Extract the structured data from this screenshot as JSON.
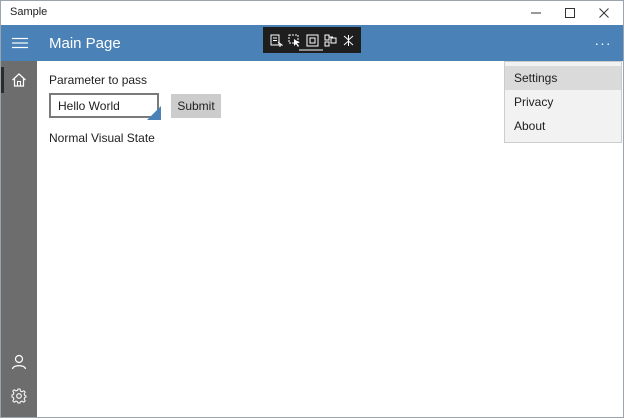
{
  "window": {
    "title": "Sample"
  },
  "title_bar_controls": {
    "minimize_icon": "minimize-icon",
    "maximize_icon": "maximize-icon",
    "close_icon": "close-icon"
  },
  "header": {
    "page_title": "Main Page",
    "menu_icon": "hamburger-icon",
    "more_icon": "more-icon",
    "more_label": "···",
    "color": "#4a82b8"
  },
  "debug_toolbar": {
    "tools": [
      "live-visual-tree-icon",
      "select-element-icon",
      "display-layout-adorners-icon",
      "track-focus-icon",
      "hot-reload-icon"
    ]
  },
  "nav": {
    "items": [
      {
        "icon": "home-icon",
        "selected": true
      },
      {
        "icon": "user-icon",
        "selected": false
      },
      {
        "icon": "settings-icon",
        "selected": false
      }
    ],
    "color": "#6d6d6d"
  },
  "form": {
    "param_label": "Parameter to pass",
    "param_value": "Hello World",
    "submit_label": "Submit",
    "state_text": "Normal Visual State"
  },
  "overflow_menu": {
    "items": [
      {
        "label": "Settings",
        "highlighted": true
      },
      {
        "label": "Privacy",
        "highlighted": false
      },
      {
        "label": "About",
        "highlighted": false
      }
    ]
  }
}
